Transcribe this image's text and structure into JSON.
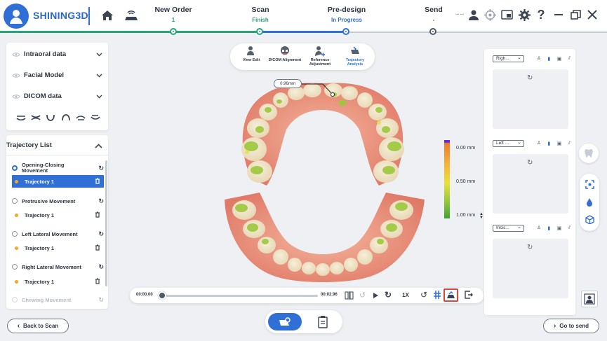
{
  "brand": {
    "name": "SHINING3D"
  },
  "steps": [
    {
      "title": "New Order",
      "status": "1",
      "status_color": "#2aa37a"
    },
    {
      "title": "Scan",
      "status": "Finish",
      "status_color": "#2aa37a"
    },
    {
      "title": "Pre-design",
      "status": "In Progress",
      "status_color": "#2f6fd6"
    },
    {
      "title": "Send",
      "status": "-",
      "status_color": "#4a5a6a"
    }
  ],
  "top_right_small_text": "▪▪▪ ▪▪▪",
  "left_panel": {
    "data_items": [
      {
        "label": "Intraoral data"
      },
      {
        "label": "Facial Model"
      },
      {
        "label": "DICOM data"
      }
    ]
  },
  "trajectory_list": {
    "title": "Trajectory List",
    "groups": [
      {
        "name": "Opening-Closing Movement",
        "selected": true,
        "trajectory": "Trajectory 1",
        "trajectory_selected": true
      },
      {
        "name": "Protrusive Movement",
        "selected": false,
        "trajectory": "Trajectory 1",
        "trajectory_selected": false
      },
      {
        "name": "Left Lateral Movement",
        "selected": false,
        "trajectory": "Trajectory 1",
        "trajectory_selected": false
      },
      {
        "name": "Right Lateral Movement",
        "selected": false,
        "trajectory": "Trajectory 1",
        "trajectory_selected": false
      },
      {
        "name": "Chewing Movement",
        "selected": false,
        "disabled": true
      }
    ]
  },
  "top_tools": [
    {
      "label": "View Edit",
      "active": false
    },
    {
      "label": "DICOM Alignment",
      "active": false
    },
    {
      "label": "Reference Adjustment",
      "active": false
    },
    {
      "label": "Trajectory Analysis",
      "active": true
    }
  ],
  "measurement": "0.96mm",
  "legend": {
    "labels": [
      "0.00 mm",
      "0.50 mm",
      "1.00 mm"
    ]
  },
  "playback": {
    "start_time": "00:00.00",
    "end_time": "00:02.96",
    "speed": "1X",
    "progress": 0
  },
  "views": [
    {
      "select": "Righ..."
    },
    {
      "select": "Left ..."
    },
    {
      "select": "Incis..."
    }
  ],
  "buttons": {
    "back": "Back to Scan",
    "next": "Go to send"
  },
  "colors": {
    "accent": "#2f6fd6",
    "success": "#2aa37a",
    "highlight_border": "#e0453a"
  }
}
